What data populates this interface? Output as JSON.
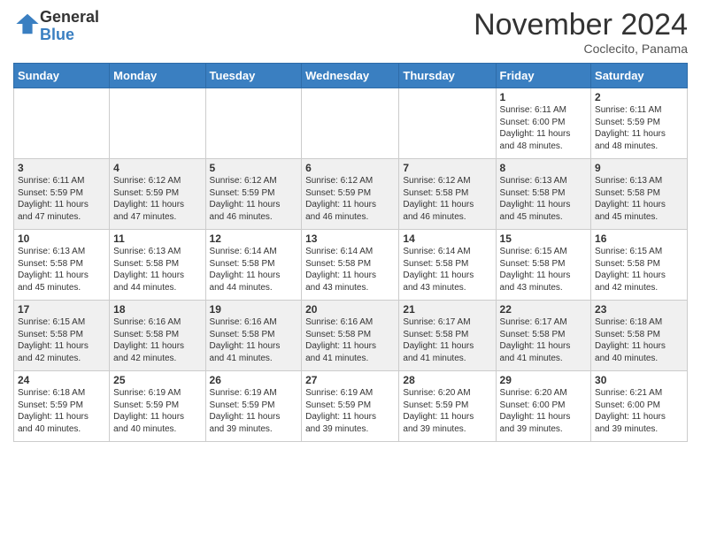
{
  "header": {
    "logo_line1": "General",
    "logo_line2": "Blue",
    "month_title": "November 2024",
    "location": "Coclecito, Panama"
  },
  "weekdays": [
    "Sunday",
    "Monday",
    "Tuesday",
    "Wednesday",
    "Thursday",
    "Friday",
    "Saturday"
  ],
  "weeks": [
    [
      {
        "day": "",
        "info": ""
      },
      {
        "day": "",
        "info": ""
      },
      {
        "day": "",
        "info": ""
      },
      {
        "day": "",
        "info": ""
      },
      {
        "day": "",
        "info": ""
      },
      {
        "day": "1",
        "info": "Sunrise: 6:11 AM\nSunset: 6:00 PM\nDaylight: 11 hours\nand 48 minutes."
      },
      {
        "day": "2",
        "info": "Sunrise: 6:11 AM\nSunset: 5:59 PM\nDaylight: 11 hours\nand 48 minutes."
      }
    ],
    [
      {
        "day": "3",
        "info": "Sunrise: 6:11 AM\nSunset: 5:59 PM\nDaylight: 11 hours\nand 47 minutes."
      },
      {
        "day": "4",
        "info": "Sunrise: 6:12 AM\nSunset: 5:59 PM\nDaylight: 11 hours\nand 47 minutes."
      },
      {
        "day": "5",
        "info": "Sunrise: 6:12 AM\nSunset: 5:59 PM\nDaylight: 11 hours\nand 46 minutes."
      },
      {
        "day": "6",
        "info": "Sunrise: 6:12 AM\nSunset: 5:59 PM\nDaylight: 11 hours\nand 46 minutes."
      },
      {
        "day": "7",
        "info": "Sunrise: 6:12 AM\nSunset: 5:58 PM\nDaylight: 11 hours\nand 46 minutes."
      },
      {
        "day": "8",
        "info": "Sunrise: 6:13 AM\nSunset: 5:58 PM\nDaylight: 11 hours\nand 45 minutes."
      },
      {
        "day": "9",
        "info": "Sunrise: 6:13 AM\nSunset: 5:58 PM\nDaylight: 11 hours\nand 45 minutes."
      }
    ],
    [
      {
        "day": "10",
        "info": "Sunrise: 6:13 AM\nSunset: 5:58 PM\nDaylight: 11 hours\nand 45 minutes."
      },
      {
        "day": "11",
        "info": "Sunrise: 6:13 AM\nSunset: 5:58 PM\nDaylight: 11 hours\nand 44 minutes."
      },
      {
        "day": "12",
        "info": "Sunrise: 6:14 AM\nSunset: 5:58 PM\nDaylight: 11 hours\nand 44 minutes."
      },
      {
        "day": "13",
        "info": "Sunrise: 6:14 AM\nSunset: 5:58 PM\nDaylight: 11 hours\nand 43 minutes."
      },
      {
        "day": "14",
        "info": "Sunrise: 6:14 AM\nSunset: 5:58 PM\nDaylight: 11 hours\nand 43 minutes."
      },
      {
        "day": "15",
        "info": "Sunrise: 6:15 AM\nSunset: 5:58 PM\nDaylight: 11 hours\nand 43 minutes."
      },
      {
        "day": "16",
        "info": "Sunrise: 6:15 AM\nSunset: 5:58 PM\nDaylight: 11 hours\nand 42 minutes."
      }
    ],
    [
      {
        "day": "17",
        "info": "Sunrise: 6:15 AM\nSunset: 5:58 PM\nDaylight: 11 hours\nand 42 minutes."
      },
      {
        "day": "18",
        "info": "Sunrise: 6:16 AM\nSunset: 5:58 PM\nDaylight: 11 hours\nand 42 minutes."
      },
      {
        "day": "19",
        "info": "Sunrise: 6:16 AM\nSunset: 5:58 PM\nDaylight: 11 hours\nand 41 minutes."
      },
      {
        "day": "20",
        "info": "Sunrise: 6:16 AM\nSunset: 5:58 PM\nDaylight: 11 hours\nand 41 minutes."
      },
      {
        "day": "21",
        "info": "Sunrise: 6:17 AM\nSunset: 5:58 PM\nDaylight: 11 hours\nand 41 minutes."
      },
      {
        "day": "22",
        "info": "Sunrise: 6:17 AM\nSunset: 5:58 PM\nDaylight: 11 hours\nand 41 minutes."
      },
      {
        "day": "23",
        "info": "Sunrise: 6:18 AM\nSunset: 5:58 PM\nDaylight: 11 hours\nand 40 minutes."
      }
    ],
    [
      {
        "day": "24",
        "info": "Sunrise: 6:18 AM\nSunset: 5:59 PM\nDaylight: 11 hours\nand 40 minutes."
      },
      {
        "day": "25",
        "info": "Sunrise: 6:19 AM\nSunset: 5:59 PM\nDaylight: 11 hours\nand 40 minutes."
      },
      {
        "day": "26",
        "info": "Sunrise: 6:19 AM\nSunset: 5:59 PM\nDaylight: 11 hours\nand 39 minutes."
      },
      {
        "day": "27",
        "info": "Sunrise: 6:19 AM\nSunset: 5:59 PM\nDaylight: 11 hours\nand 39 minutes."
      },
      {
        "day": "28",
        "info": "Sunrise: 6:20 AM\nSunset: 5:59 PM\nDaylight: 11 hours\nand 39 minutes."
      },
      {
        "day": "29",
        "info": "Sunrise: 6:20 AM\nSunset: 6:00 PM\nDaylight: 11 hours\nand 39 minutes."
      },
      {
        "day": "30",
        "info": "Sunrise: 6:21 AM\nSunset: 6:00 PM\nDaylight: 11 hours\nand 39 minutes."
      }
    ]
  ]
}
